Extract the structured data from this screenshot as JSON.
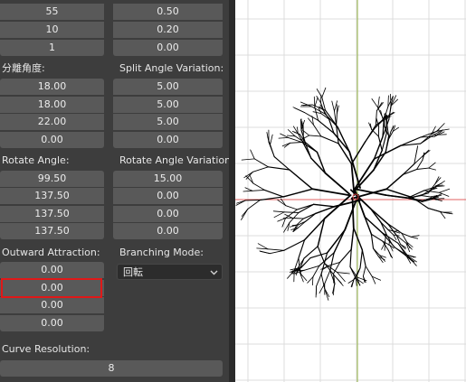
{
  "top_left_values": [
    "55",
    "10",
    "1"
  ],
  "top_right_values": [
    "0.50",
    "0.20",
    "0.00"
  ],
  "split_angle": {
    "label": "分離角度:",
    "values": [
      "18.00",
      "18.00",
      "22.00",
      "0.00"
    ]
  },
  "split_angle_variation": {
    "label": "Split Angle Variation:",
    "values": [
      "5.00",
      "5.00",
      "5.00",
      "0.00"
    ]
  },
  "rotate_angle": {
    "label": "Rotate Angle:",
    "values": [
      "99.50",
      "137.50",
      "137.50",
      "137.50"
    ]
  },
  "rotate_angle_variation": {
    "label": "Rotate Angle Variation:",
    "values": [
      "15.00",
      "0.00",
      "0.00",
      "0.00"
    ]
  },
  "outward_attraction": {
    "label": "Outward Attraction:",
    "values": [
      "0.00",
      "0.00",
      "0.00",
      "0.00"
    ]
  },
  "branching_mode": {
    "label": "Branching Mode:",
    "value": "回転",
    "chevron_icon": "chevron-down-icon"
  },
  "curve_resolution": {
    "label": "Curve Resolution:",
    "value": "8"
  },
  "colors": {
    "panel_bg": "#3d3d3d",
    "field_bg": "#595959",
    "highlight": "#e01818",
    "viewport_bg": "#ffffff",
    "grid": "#dcdcdc",
    "axis_x": "#e06060",
    "axis_y": "#90b040"
  }
}
